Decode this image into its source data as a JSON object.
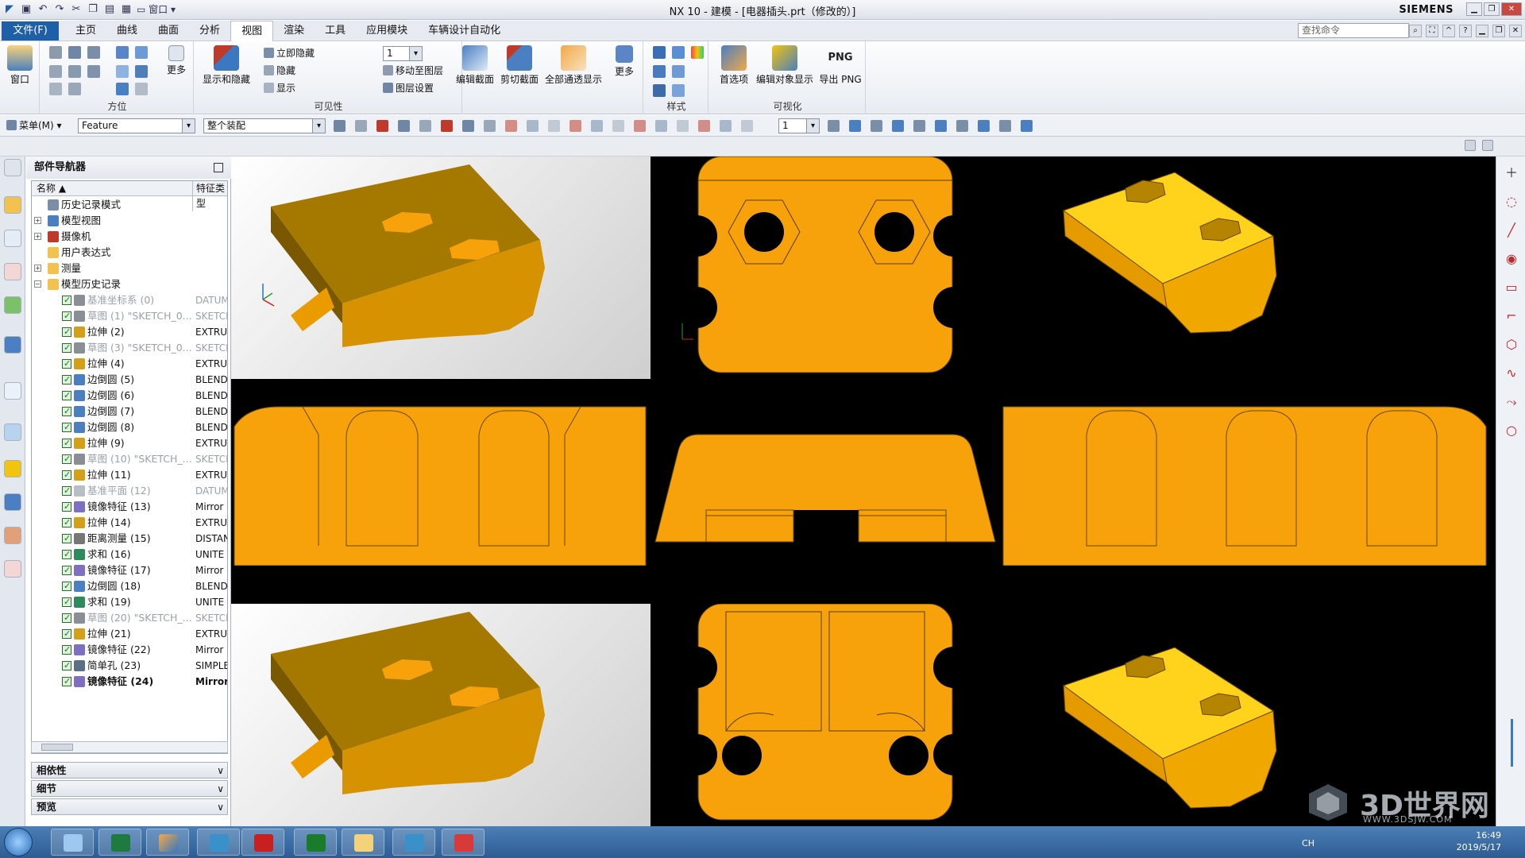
{
  "window": {
    "title": "NX 10 - 建模 - [电器插头.prt（修改的）]",
    "brand": "SIEMENS"
  },
  "menubar": {
    "file_tab": "文件(F)",
    "tabs": [
      "主页",
      "曲线",
      "曲面",
      "分析",
      "视图",
      "渲染",
      "工具",
      "应用模块",
      "车辆设计自动化"
    ],
    "active_tab": "视图",
    "search_placeholder": "查找命令"
  },
  "quick_access": {
    "window_label": "窗口"
  },
  "ribbon": {
    "window_btn": "窗口",
    "more1": "更多",
    "group_orient": "方位",
    "show_hide": "显示和隐藏",
    "immediate_hide": "立即隐藏",
    "hide": "隐藏",
    "show": "显示",
    "layer_combo": "1",
    "move_to_layer": "移动至图层",
    "layer_settings": "图层设置",
    "edit_section": "编辑截面",
    "clip_section": "剪切截面",
    "all_see_through": "全部通透显示",
    "more2": "更多",
    "group_visibility": "可见性",
    "group_style": "样式",
    "preferences": "首选项",
    "edit_object_display": "编辑对象显示",
    "export_png": "导出 PNG",
    "png_icon_text": "PNG",
    "group_visualization": "可视化"
  },
  "toolbar2": {
    "menu": "菜单(M)",
    "filter": "Feature",
    "scope": "整个装配",
    "layer": "1"
  },
  "navigator": {
    "title": "部件导航器",
    "col_name": "名称",
    "col_type": "特征类型",
    "top_items": [
      {
        "label": "历史记录模式"
      },
      {
        "label": "模型视图",
        "expander": "+"
      },
      {
        "label": "摄像机",
        "expander": "+"
      },
      {
        "label": "用户表达式"
      },
      {
        "label": "测量",
        "expander": "+"
      },
      {
        "label": "模型历史记录",
        "expander": "−"
      }
    ],
    "features": [
      {
        "name": "基准坐标系 (0)",
        "type": "DATUM",
        "gray": true,
        "color": "#8a8f96"
      },
      {
        "name": "草图 (1) \"SKETCH_0...",
        "type": "SKETCH",
        "gray": true,
        "color": "#8a8f96"
      },
      {
        "name": "拉伸 (2)",
        "type": "EXTRUDE",
        "color": "#d4a017"
      },
      {
        "name": "草图 (3) \"SKETCH_0...",
        "type": "SKETCH",
        "gray": true,
        "color": "#8a8f96"
      },
      {
        "name": "拉伸 (4)",
        "type": "EXTRUDE",
        "color": "#d4a017"
      },
      {
        "name": "边倒圆 (5)",
        "type": "BLEND",
        "color": "#4a7fc1"
      },
      {
        "name": "边倒圆 (6)",
        "type": "BLEND",
        "color": "#4a7fc1"
      },
      {
        "name": "边倒圆 (7)",
        "type": "BLEND",
        "color": "#4a7fc1"
      },
      {
        "name": "边倒圆 (8)",
        "type": "BLEND",
        "color": "#4a7fc1"
      },
      {
        "name": "拉伸 (9)",
        "type": "EXTRUDE",
        "color": "#d4a017"
      },
      {
        "name": "草图 (10) \"SKETCH_...",
        "type": "SKETCH",
        "gray": true,
        "color": "#8a8f96"
      },
      {
        "name": "拉伸 (11)",
        "type": "EXTRUDE",
        "color": "#d4a017"
      },
      {
        "name": "基准平面 (12)",
        "type": "DATUM",
        "gray": true,
        "color": "#b9bec5"
      },
      {
        "name": "镜像特征 (13)",
        "type": "Mirror F",
        "color": "#7e6fc4"
      },
      {
        "name": "拉伸 (14)",
        "type": "EXTRUDE",
        "color": "#d4a017"
      },
      {
        "name": "距离测量 (15)",
        "type": "DISTANCE",
        "color": "#777"
      },
      {
        "name": "求和 (16)",
        "type": "UNITE",
        "color": "#2d8a5a"
      },
      {
        "name": "镜像特征 (17)",
        "type": "Mirror F",
        "color": "#7e6fc4"
      },
      {
        "name": "边倒圆 (18)",
        "type": "BLEND",
        "color": "#4a7fc1"
      },
      {
        "name": "求和 (19)",
        "type": "UNITE",
        "color": "#2d8a5a"
      },
      {
        "name": "草图 (20) \"SKETCH_...",
        "type": "SKETCH",
        "gray": true,
        "color": "#8a8f96"
      },
      {
        "name": "拉伸 (21)",
        "type": "EXTRUDE",
        "color": "#d4a017"
      },
      {
        "name": "镜像特征 (22)",
        "type": "Mirror F",
        "color": "#7e6fc4"
      },
      {
        "name": "简单孔 (23)",
        "type": "SIMPLE",
        "color": "#5b6f86"
      },
      {
        "name": "镜像特征 (24)",
        "type": "Mirror",
        "color": "#7e6fc4",
        "bold": true
      }
    ],
    "panels": [
      "相依性",
      "细节",
      "预览"
    ]
  },
  "colors": {
    "part": "#f7a20a",
    "part_dark": "#b07000",
    "part_light": "#ffc94a",
    "accent": "#1e5fa8"
  },
  "watermark": {
    "text": "3D世界网",
    "url": "WWW.3DSJW.COM"
  },
  "taskbar": {
    "lang": "CH",
    "time": "16:49",
    "date": "2019/5/17"
  }
}
